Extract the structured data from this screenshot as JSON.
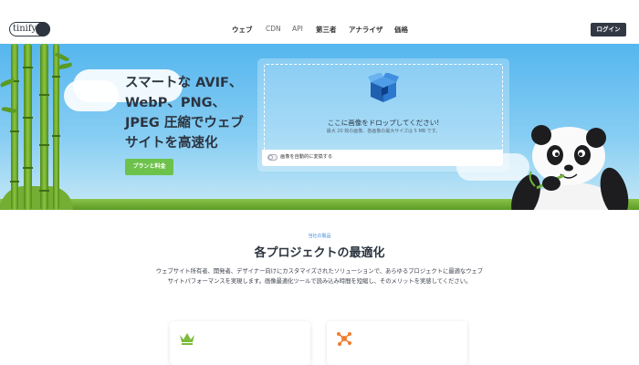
{
  "header": {
    "logo_text": "tinify",
    "nav": [
      "ウェブ",
      "CDN",
      "API",
      "第三者",
      "アナライザ",
      "価格"
    ],
    "login_label": "ログイン"
  },
  "hero": {
    "title_lines": [
      "スマートな AVIF、",
      "WebP、PNG、",
      "JPEG 圧縮でウェブ",
      "サイトを高速化"
    ],
    "cta_label": "プランと料金",
    "drop_title": "ここに画像をドロップしてください!",
    "drop_subtitle": "最大 20 枚の画像、各画像の最大サイズは 5 MB です。",
    "toggle_label": "画像を自動的に変換する",
    "toggle_on": false
  },
  "section": {
    "tag": "当社の製品",
    "title": "各プロジェクトの最適化",
    "description": "ウェブサイト所有者、開発者、デザイナー向けにカスタマイズされたソリューションで、あらゆるプロジェクトに最適なウェブサイトパフォーマンスを実現します。画像最適化ツールで読み込み時間を短縮し、そのメリットを実感してください。"
  },
  "cards": [
    {
      "icon": "crown-icon"
    },
    {
      "icon": "share-icon"
    }
  ],
  "colors": {
    "accent_green": "#6cc24a",
    "dark": "#323844",
    "link_blue": "#3c8ad8",
    "crown": "#7dbb3a",
    "share": "#ef7d2e"
  }
}
